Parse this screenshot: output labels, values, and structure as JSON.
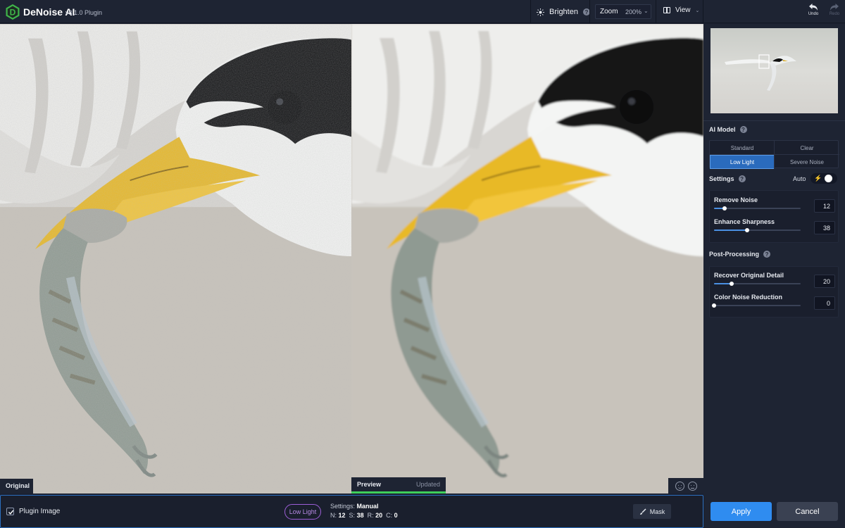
{
  "app": {
    "name": "DeNoise AI",
    "version": "v3.1.0 Plugin",
    "logo_letter": "D"
  },
  "toolbar": {
    "brighten_label": "Brighten",
    "zoom_label": "Zoom",
    "zoom_value": "200%",
    "view_label": "View",
    "undo_label": "Undo",
    "redo_label": "Redo"
  },
  "panes": {
    "original_label": "Original",
    "preview_label": "Preview",
    "preview_status": "Updated",
    "preview_progress": 1.0
  },
  "navigator": {
    "thumbnail": "bird-in-flight"
  },
  "ai_model": {
    "title": "AI Model",
    "options": [
      "Standard",
      "Clear",
      "Low Light",
      "Severe Noise"
    ],
    "selected": "Low Light"
  },
  "settings": {
    "title": "Settings",
    "auto_label": "Auto",
    "auto_on": false,
    "sliders": [
      {
        "label": "Remove Noise",
        "value": "12",
        "fraction": 0.12
      },
      {
        "label": "Enhance Sharpness",
        "value": "38",
        "fraction": 0.38
      }
    ]
  },
  "post_processing": {
    "title": "Post-Processing",
    "sliders": [
      {
        "label": "Recover Original Detail",
        "value": "20",
        "fraction": 0.2
      },
      {
        "label": "Color Noise Reduction",
        "value": "0",
        "fraction": 0.0
      }
    ]
  },
  "footer": {
    "plugin_label": "Plugin Image",
    "plugin_checked": true,
    "model_pill": "Low Light",
    "settings_prefix": "Settings:",
    "settings_mode": "Manual",
    "values": [
      {
        "key": "N:",
        "value": "12"
      },
      {
        "key": "S:",
        "value": "38"
      },
      {
        "key": "R:",
        "value": "20"
      },
      {
        "key": "C:",
        "value": "0"
      }
    ],
    "mask_label": "Mask",
    "apply_label": "Apply",
    "cancel_label": "Cancel"
  },
  "colors": {
    "accent": "#2f8cf0",
    "selected_model": "#2a6bbd",
    "model_pill": "#9d5fd8",
    "progress": "#3fcf5a",
    "logo": "#3fb54a"
  }
}
